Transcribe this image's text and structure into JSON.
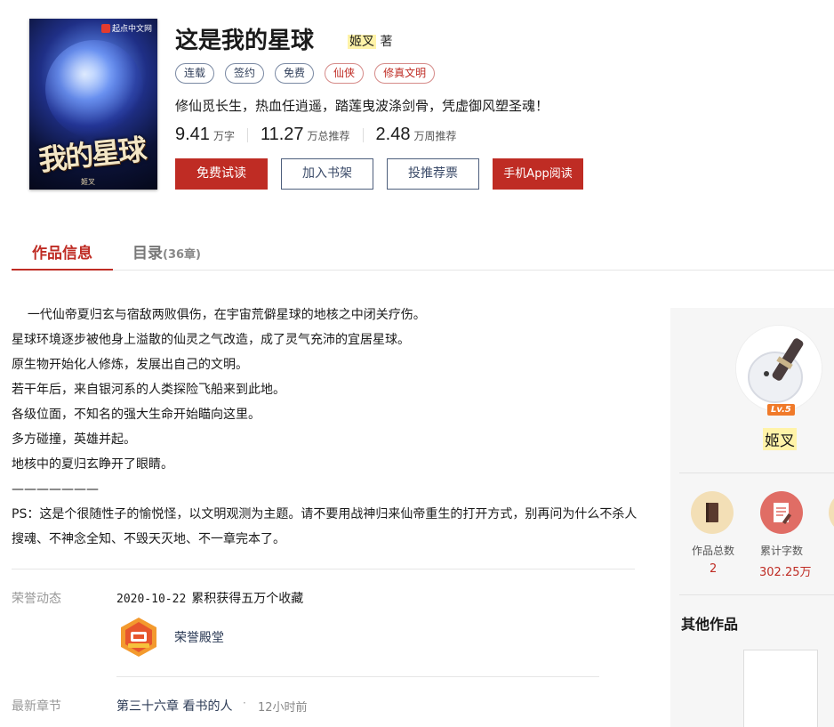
{
  "book": {
    "title": "这是我的星球",
    "author_name": "姬叉",
    "author_suffix": "著",
    "cover": {
      "publisher": "起点中文网",
      "art_title": "我的星球",
      "art_author": "姬叉"
    },
    "tags": [
      {
        "label": "连载",
        "style": "neutral"
      },
      {
        "label": "签约",
        "style": "neutral"
      },
      {
        "label": "免费",
        "style": "neutral"
      },
      {
        "label": "仙侠",
        "style": "red"
      },
      {
        "label": "修真文明",
        "style": "red"
      }
    ],
    "intro": "修仙觅长生，热血任逍遥，踏莲曳波涤剑骨，凭虚御风塑圣魂！",
    "stats": [
      {
        "value": "9.41",
        "unit": "万字"
      },
      {
        "value": "11.27",
        "unit": "万总推荐"
      },
      {
        "value": "2.48",
        "unit": "万周推荐"
      }
    ],
    "buttons": {
      "read": "免费试读",
      "shelf": "加入书架",
      "vote": "投推荐票",
      "app": "手机App阅读"
    }
  },
  "tabs": {
    "info": "作品信息",
    "catalog": "目录",
    "catalog_count": "(36章)"
  },
  "description": [
    "    一代仙帝夏归玄与宿敌两败俱伤，在宇宙荒僻星球的地核之中闭关疗伤。",
    "星球环境逐步被他身上溢散的仙灵之气改造，成了灵气充沛的宜居星球。",
    "原生物开始化人修炼，发展出自己的文明。",
    "若干年后，来自银河系的人类探险飞船来到此地。",
    "各级位面，不知名的强大生命开始瞄向这里。",
    "多方碰撞，英雄并起。",
    "地核中的夏归玄睁开了眼睛。",
    "———————",
    "PS：这是个很随性子的愉悦怪，以文明观测为主题。请不要用战神归来仙帝重生的打开方式，别再问为什么不杀人搜魂、不神念全知、不毁天灭地、不一章完本了。"
  ],
  "honor": {
    "label": "荣誉动态",
    "date": "2020-10-22",
    "text": "累积获得五万个收藏",
    "badge_label": "荣誉殿堂"
  },
  "latest": {
    "label": "最新章节",
    "chapter": "第三十六章 看书的人",
    "dot": "·",
    "time": "12小时前"
  },
  "sidebar": {
    "level": "Lv.5",
    "username": "姬叉",
    "stats": [
      {
        "label": "作品总数",
        "value": "2"
      },
      {
        "label": "累计字数",
        "value": "302.25万"
      }
    ],
    "other_works_title": "其他作品"
  },
  "colors": {
    "accent_red": "#bf2c24",
    "highlight_yellow": "#fff3a8"
  }
}
